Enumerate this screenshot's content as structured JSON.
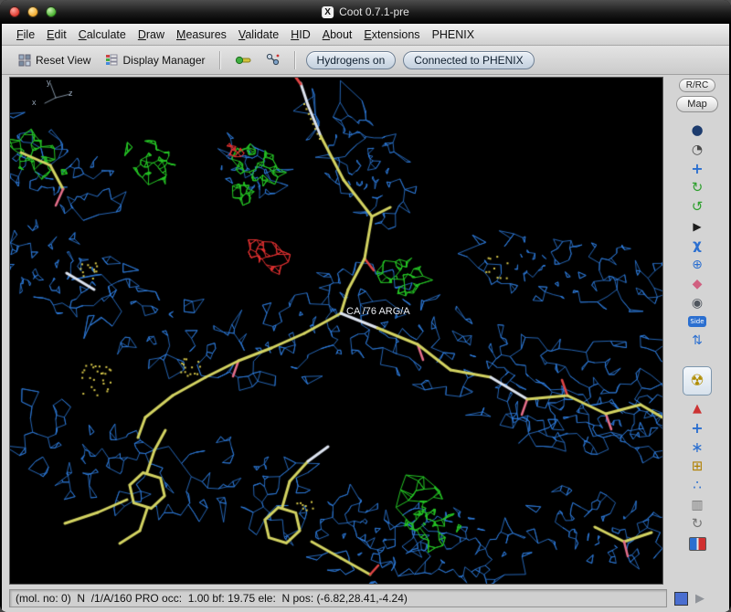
{
  "window": {
    "title": "Coot 0.7.1-pre",
    "x_icon": "X"
  },
  "menubar": {
    "items": [
      {
        "label": "File"
      },
      {
        "label": "Edit"
      },
      {
        "label": "Calculate"
      },
      {
        "label": "Draw"
      },
      {
        "label": "Measures"
      },
      {
        "label": "Validate"
      },
      {
        "label": "HID"
      },
      {
        "label": "About"
      },
      {
        "label": "Extensions"
      },
      {
        "label": "PHENIX"
      }
    ]
  },
  "toolbar": {
    "reset_view": "Reset View",
    "display_manager": "Display Manager",
    "hydrogens_toggle": "Hydrogens on",
    "phenix_status": "Connected to PHENIX"
  },
  "right_panel": {
    "rrc_button": "R/RC",
    "map_button": "Map",
    "icons": [
      {
        "name": "sphere-icon",
        "glyph": "●"
      },
      {
        "name": "clock-icon",
        "glyph": "◔"
      },
      {
        "name": "translate-icon",
        "glyph": "+"
      },
      {
        "name": "rotate-cw-icon",
        "glyph": "↻"
      },
      {
        "name": "rotate-ccw-icon",
        "glyph": "↺"
      },
      {
        "name": "play-icon",
        "glyph": "▶"
      },
      {
        "name": "chi-angles-icon",
        "glyph": "χ"
      },
      {
        "name": "atom-pair-icon",
        "glyph": "⊕"
      },
      {
        "name": "rama-icon",
        "glyph": "◆"
      },
      {
        "name": "eye-icon",
        "glyph": "◉"
      },
      {
        "name": "side-chain-chip",
        "glyph": "Side"
      },
      {
        "name": "flip-icon",
        "glyph": "⇅"
      },
      {
        "name": "radiation-icon",
        "glyph": "☢"
      },
      {
        "name": "hazard-icon",
        "glyph": "▲"
      },
      {
        "name": "cross-tool-icon",
        "glyph": "+"
      },
      {
        "name": "star-tool-icon",
        "glyph": "∗"
      },
      {
        "name": "add-atom-icon",
        "glyph": "⊞"
      },
      {
        "name": "water-dots-icon",
        "glyph": "∴"
      },
      {
        "name": "trash-icon",
        "glyph": "▥"
      },
      {
        "name": "refresh-icon",
        "glyph": "↻"
      },
      {
        "name": "flag-chip",
        "glyph": ""
      }
    ]
  },
  "canvas": {
    "atom_label": "CA /76 ARG/A",
    "axes": {
      "x": "x",
      "y": "y",
      "z": "z"
    }
  },
  "statusbar": {
    "text": "(mol. no: 0)  N  /1/A/160 PRO occ:  1.00 bf: 19.75 ele:  N pos: (-6.82,28.41,-4.24)"
  }
}
